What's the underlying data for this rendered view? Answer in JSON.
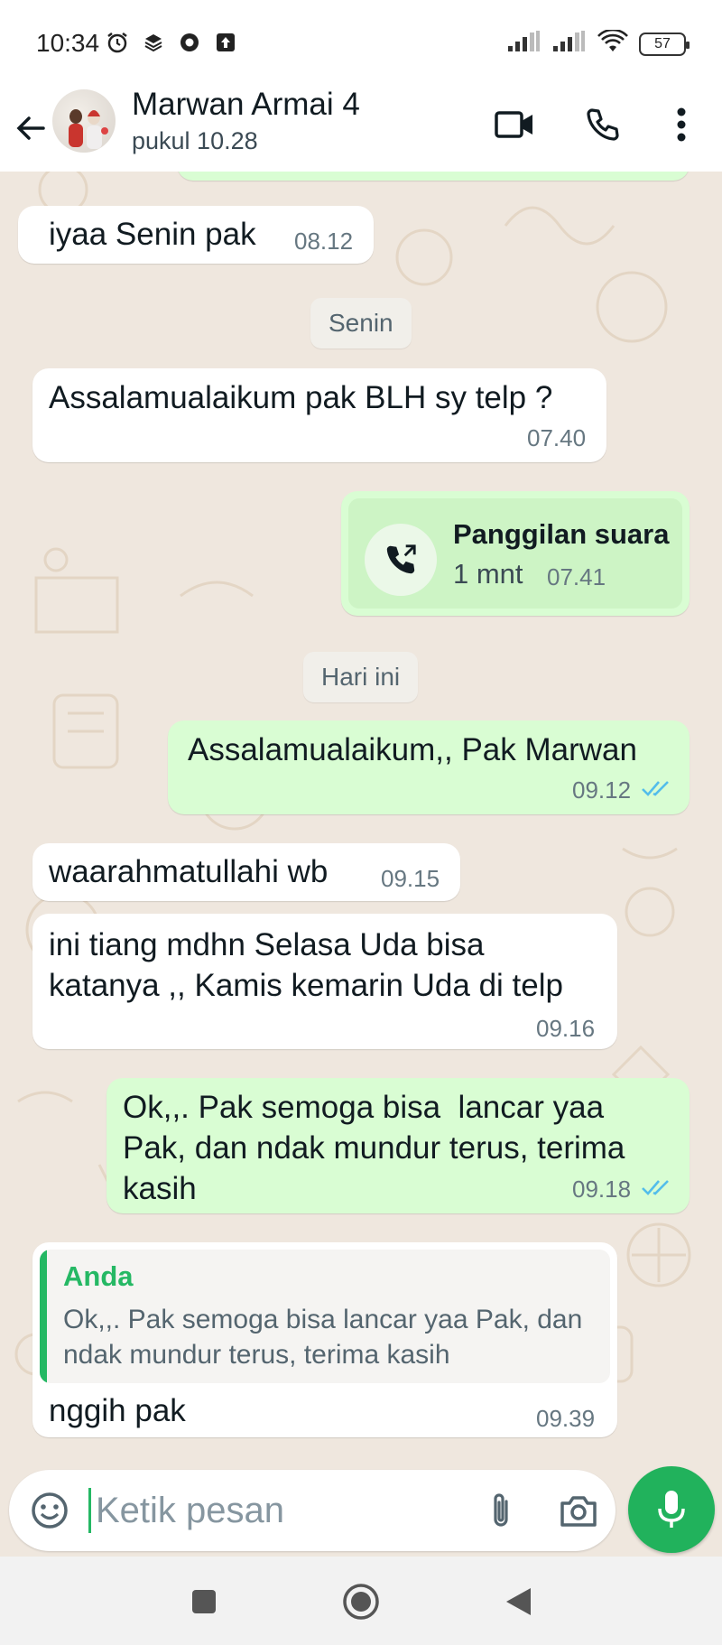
{
  "status_bar": {
    "time": "10:34",
    "battery": "57",
    "icons": [
      "alarm-icon",
      "layers-icon",
      "sync-icon",
      "upload-icon",
      "signal-icon",
      "signal-icon",
      "wifi-icon",
      "battery-icon"
    ]
  },
  "header": {
    "contact_name": "Marwan Armai 4",
    "last_seen": "pukul 10.28"
  },
  "messages": [
    {
      "direction": "in",
      "text": "iyaa Senin pak",
      "time": "08.12"
    },
    {
      "type": "date",
      "label": "Senin"
    },
    {
      "direction": "in",
      "text": "Assalamualaikum pak BLH sy telp ?",
      "time": "07.40"
    },
    {
      "direction": "out",
      "type": "call",
      "title": "Panggilan suara",
      "duration": "1 mnt",
      "time": "07.41"
    },
    {
      "type": "date",
      "label": "Hari ini"
    },
    {
      "direction": "out",
      "text": "Assalamualaikum,, Pak Marwan",
      "time": "09.12",
      "read": true
    },
    {
      "direction": "in",
      "text": "waarahmatullahi wb",
      "time": "09.15"
    },
    {
      "direction": "in",
      "text": "ini tiang mdhn Selasa Uda bisa\nkatanya ,, Kamis kemarin Uda di telp",
      "time": "09.16"
    },
    {
      "direction": "out",
      "text": "Ok,,. Pak semoga bisa  lancar yaa\nPak, dan ndak mundur terus, terima\nkasih",
      "time": "09.18",
      "read": true
    },
    {
      "direction": "in",
      "quote": {
        "author": "Anda",
        "text": "Ok,,. Pak semoga bisa  lancar yaa Pak, dan ndak mundur terus, terima kasih"
      },
      "text": "nggih pak",
      "time": "09.39"
    }
  ],
  "composer": {
    "placeholder": "Ketik pesan"
  },
  "colors": {
    "accent": "#21b25c",
    "outgoing_bubble": "#d9fdd3",
    "incoming_bubble": "#ffffff",
    "chat_background": "#efe7de",
    "read_ticks": "#53bdeb"
  }
}
